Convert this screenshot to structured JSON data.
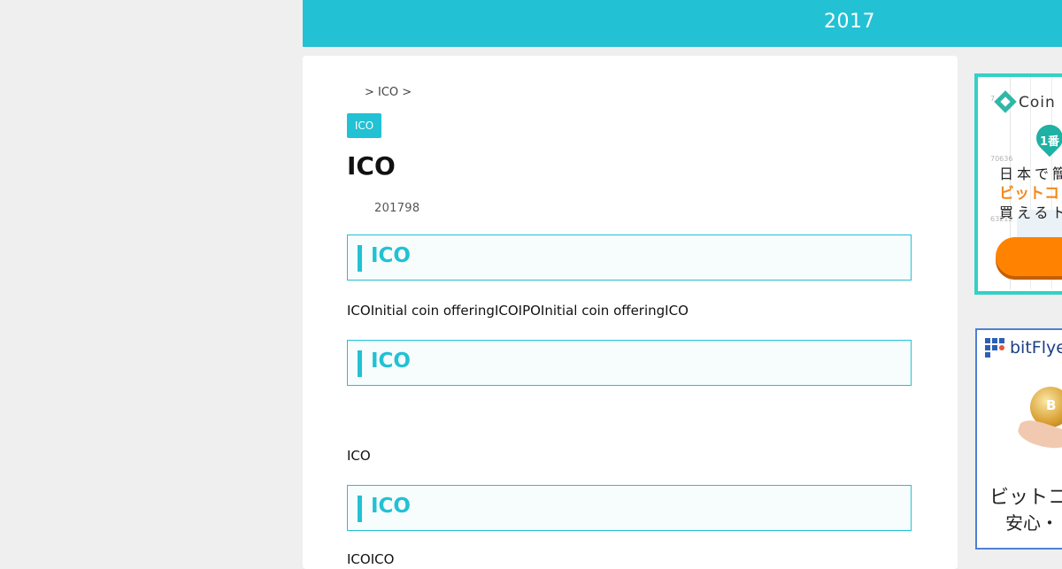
{
  "header": {
    "title": "2017"
  },
  "breadcrumb": {
    "text": "> ICO >"
  },
  "article": {
    "category": "ICO",
    "title": "ICO",
    "date": "201798",
    "sections": [
      {
        "heading": "ICO",
        "body": "ICOInitial coin offeringICOIPOInitial coin offeringICO"
      },
      {
        "heading": "ICO",
        "body": "ICO"
      },
      {
        "heading": "ICO",
        "body": "ICOICO"
      }
    ]
  },
  "ads": {
    "coincheck": {
      "logo_text": "Coin",
      "badge": "1番",
      "line1": "日本で簡",
      "line2": "ビットコ",
      "line3": "買えるト",
      "ticks": [
        "7",
        "70636",
        "63212"
      ],
      "accent": "#33d1c6",
      "cta_color": "#ff8300"
    },
    "bitflyer": {
      "brand": "bitFlye",
      "coin_symbol": "B",
      "line1": "ビットコ",
      "line2": "安心・",
      "border_color": "#4f7fd6"
    }
  },
  "colors": {
    "accent": "#22c1d4",
    "background": "#efefef"
  }
}
